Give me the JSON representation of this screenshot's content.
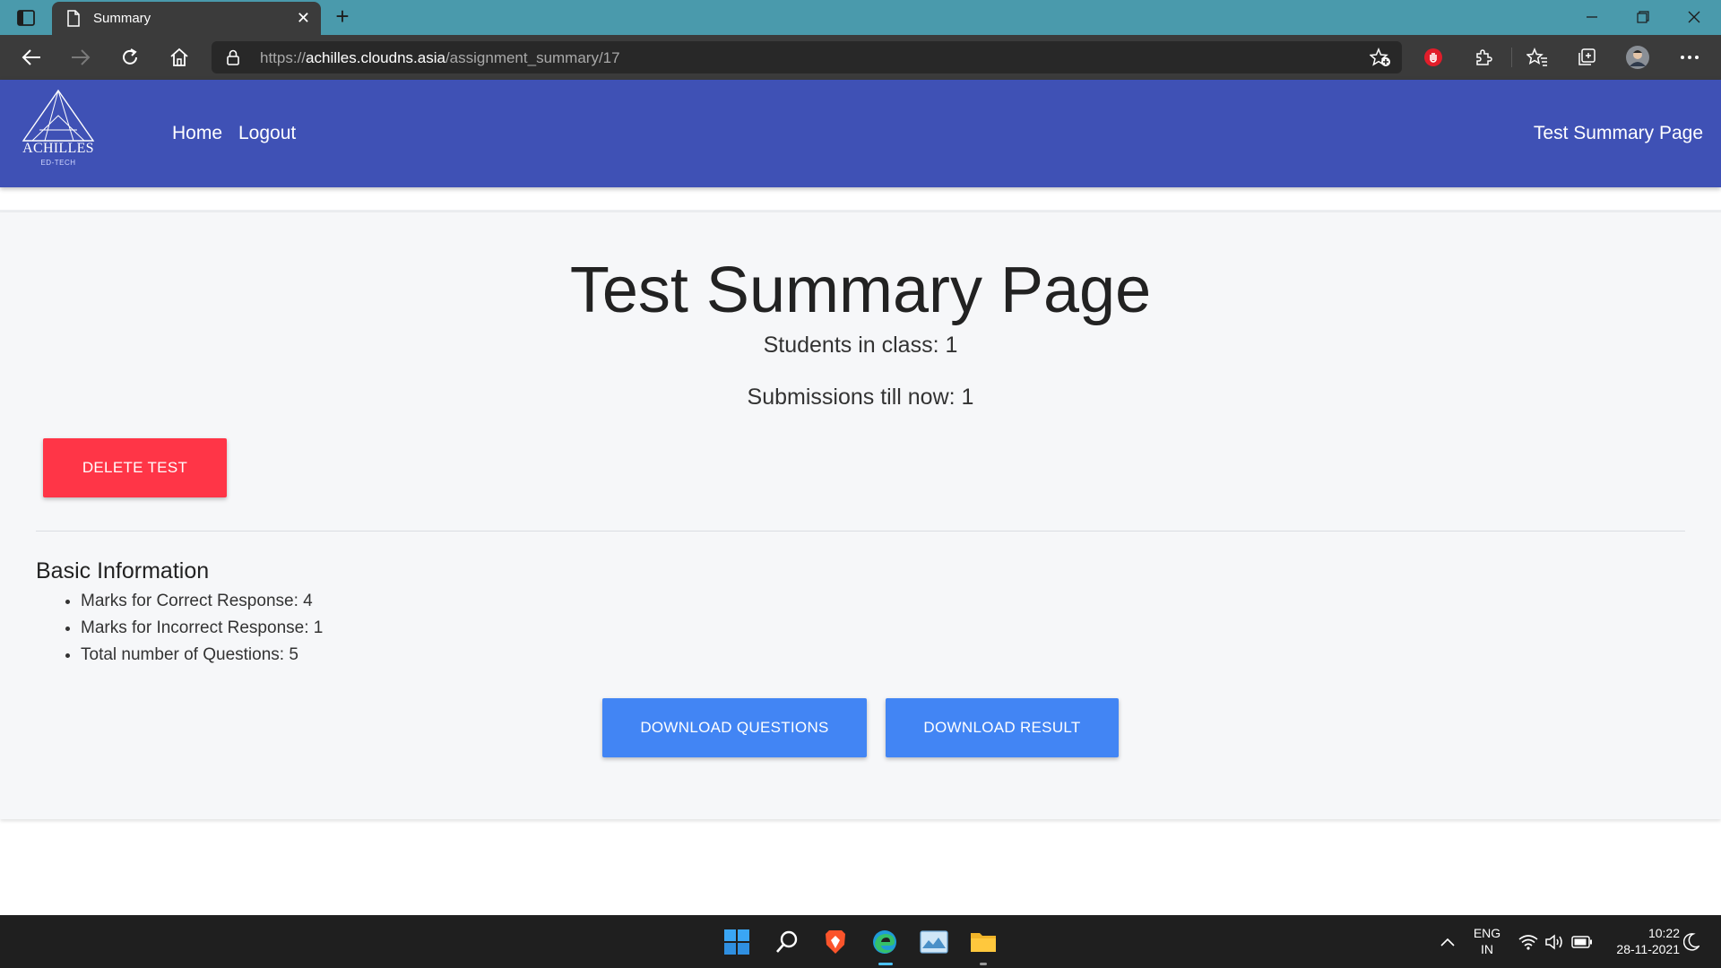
{
  "browser": {
    "tab_title": "Summary",
    "tab_close": "✕",
    "new_tab": "+",
    "url_scheme": "https://",
    "url_host": "achilles.cloudns.asia",
    "url_path": "/assignment_summary/17"
  },
  "navbar": {
    "logo_name": "ACHILLES",
    "logo_sub": "ED-TECH",
    "links": [
      "Home",
      "Logout"
    ],
    "right_title": "Test Summary Page"
  },
  "main": {
    "title": "Test Summary Page",
    "students_in_class": "Students in class: 1",
    "submissions": "Submissions till now: 1",
    "delete_button": "DELETE TEST",
    "section_title": "Basic Information",
    "info_items": [
      "Marks for Correct Response: 4",
      "Marks for Incorrect Response: 1",
      "Total number of Questions: 5"
    ],
    "download_questions_button": "DOWNLOAD QUESTIONS",
    "download_result_button": "DOWNLOAD RESULT"
  },
  "taskbar": {
    "lang_line1": "ENG",
    "lang_line2": "IN",
    "time": "10:22",
    "date": "28-11-2021"
  },
  "colors": {
    "navbar": "#3f51b5",
    "danger": "#ff3547",
    "primary": "#4285f4",
    "tabbar": "#4a9aac"
  }
}
